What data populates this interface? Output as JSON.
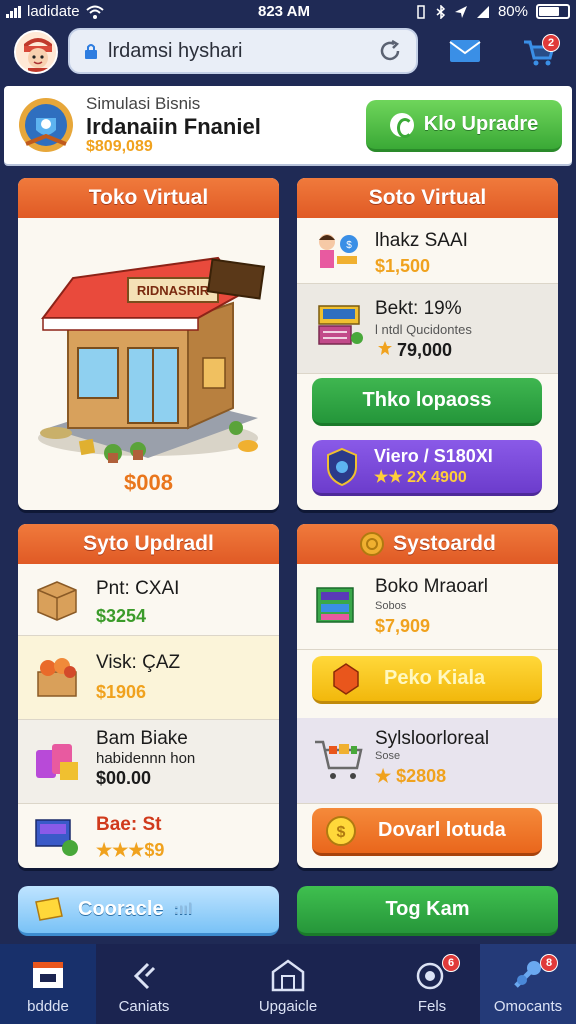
{
  "status_bar": {
    "carrier": "ladidate",
    "time": "823 AM",
    "battery": "80%"
  },
  "top_nav": {
    "search": {
      "value": "lrdamsi hyshari"
    },
    "cart_badge": "2"
  },
  "business": {
    "subtitle": "Simulasi Bisnis",
    "title": "lrdanaiin Fnaniel",
    "money": "$809,089",
    "upgrade_label": "Klo Upradre"
  },
  "card_store_visual": {
    "title": "Toko Virtual",
    "sign": "RIDNASRIR",
    "price": "$008"
  },
  "card_store_list": {
    "title": "Soto Virtual",
    "items": [
      {
        "name": "lhakz SAAI",
        "price": "$1,500"
      },
      {
        "name": "Bekt: 19%",
        "sub": "l ntdl Qucidontes",
        "price": "79,000"
      }
    ],
    "green_button": "Thko lopaoss",
    "purple_button": {
      "label": "Viero / S180XI",
      "value": "2X 4900"
    }
  },
  "card_upgrade": {
    "title": "Syto Updradl",
    "items": [
      {
        "name": "Pnt: CXAI",
        "price": "$3254"
      },
      {
        "name": "Visk: ÇAZ",
        "price": "$1906"
      },
      {
        "name": "Bam Biake",
        "sub": "habidennn hon",
        "price": "$00.00"
      },
      {
        "name": "Bae: St",
        "price": "$9"
      }
    ]
  },
  "card_systoard": {
    "title": "Systoardd",
    "items": [
      {
        "name": "Boko Mraoarl",
        "sub": "Sobos",
        "price": "$7,909"
      },
      {
        "name": "Sylsloorloreal",
        "sub": "Sose",
        "price": "$2808"
      }
    ],
    "yellow_button": "Peko Kiala",
    "orange_button": "Dovarl lotuda"
  },
  "bottom_buttons": {
    "left": "Cooracle",
    "right": "Tog Kam"
  },
  "tabs": [
    {
      "label": "bddde"
    },
    {
      "label": "Caniats"
    },
    {
      "label": "Upgaicle"
    },
    {
      "label": "Fels",
      "badge": "6"
    },
    {
      "label": "Omocants",
      "badge": "8"
    }
  ]
}
